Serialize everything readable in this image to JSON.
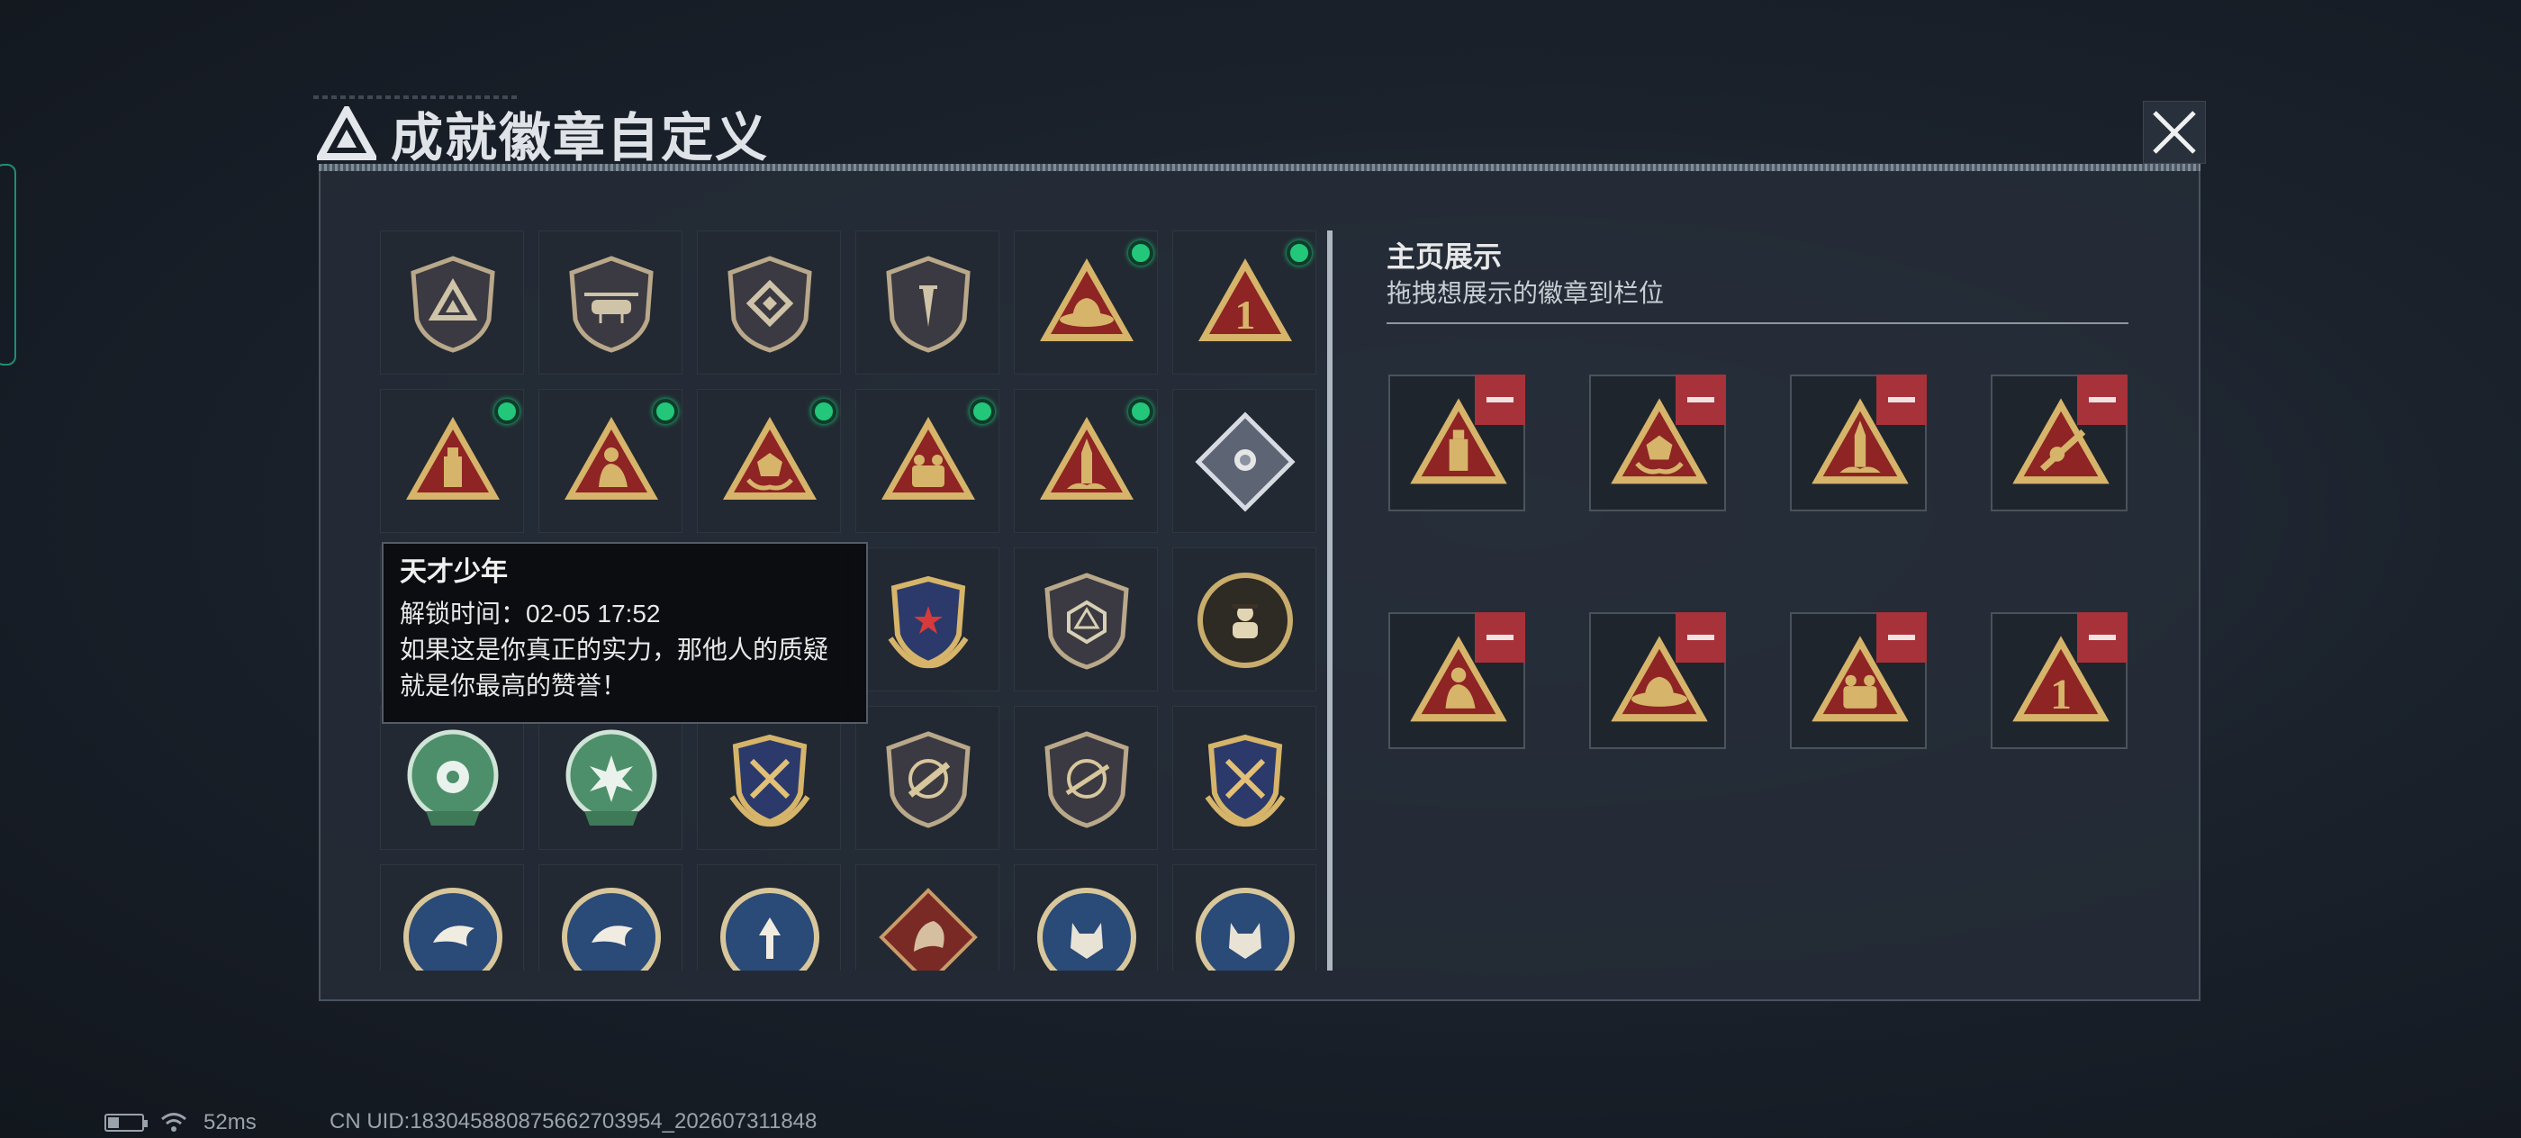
{
  "title": "成就徽章自定义",
  "grid": {
    "cells": [
      {
        "icon": "shield-triangle-badge-icon",
        "kind": "shield",
        "glyph": "triangle",
        "unlocked": false
      },
      {
        "icon": "helicopter-badge-icon",
        "kind": "shield",
        "glyph": "heli",
        "unlocked": false
      },
      {
        "icon": "diamond-emblem-badge-icon",
        "kind": "shield",
        "glyph": "diamond",
        "unlocked": false
      },
      {
        "icon": "dagger-badge-icon",
        "kind": "shield",
        "glyph": "dagger",
        "unlocked": false
      },
      {
        "icon": "hat-triangle-badge-icon",
        "kind": "triangle",
        "glyph": "hat",
        "unlocked": true
      },
      {
        "icon": "number-one-triangle-badge-icon",
        "kind": "triangle",
        "glyph": "one",
        "unlocked": true
      },
      {
        "icon": "usb-drive-triangle-badge-icon",
        "kind": "triangle",
        "glyph": "usb",
        "unlocked": true
      },
      {
        "icon": "kneeling-figure-triangle-badge-icon",
        "kind": "triangle",
        "glyph": "figure",
        "unlocked": true
      },
      {
        "icon": "dice-hands-triangle-badge-icon",
        "kind": "triangle",
        "glyph": "dice",
        "unlocked": true
      },
      {
        "icon": "soldiers-triangle-badge-icon",
        "kind": "triangle",
        "glyph": "soldiers",
        "unlocked": true
      },
      {
        "icon": "rocket-triangle-badge-icon",
        "kind": "triangle",
        "glyph": "rocket",
        "unlocked": true
      },
      {
        "icon": "rose-diamond-badge-icon",
        "kind": "diamond",
        "glyph": "rose",
        "unlocked": false
      },
      {
        "icon": "hidden-badge-icon",
        "kind": "hidden",
        "glyph": "none",
        "unlocked": false
      },
      {
        "icon": "hidden-badge-icon",
        "kind": "hidden",
        "glyph": "none",
        "unlocked": false
      },
      {
        "icon": "hidden-badge-icon",
        "kind": "hidden",
        "glyph": "none",
        "unlocked": false
      },
      {
        "icon": "star-crest-badge-icon",
        "kind": "crest",
        "glyph": "star",
        "unlocked": false
      },
      {
        "icon": "d20-shield-badge-icon",
        "kind": "shield",
        "glyph": "d20",
        "unlocked": false
      },
      {
        "icon": "spy-circle-badge-icon",
        "kind": "circle",
        "glyph": "spy",
        "unlocked": false
      },
      {
        "icon": "green-mech-badge-icon",
        "kind": "green",
        "glyph": "mech",
        "unlocked": false
      },
      {
        "icon": "green-burst-badge-icon",
        "kind": "green",
        "glyph": "burst",
        "unlocked": false
      },
      {
        "icon": "crossed-rifles-crest-badge-icon",
        "kind": "crest",
        "glyph": "rifles",
        "unlocked": false
      },
      {
        "icon": "rifle-shield-badge-icon",
        "kind": "shield",
        "glyph": "rifle",
        "unlocked": false
      },
      {
        "icon": "sniper-shield-badge-icon",
        "kind": "shield",
        "glyph": "sniper",
        "unlocked": false
      },
      {
        "icon": "crossed-rifles-crest-badge-icon",
        "kind": "crest",
        "glyph": "rifles",
        "unlocked": false
      },
      {
        "icon": "eagle-medal-badge-icon",
        "kind": "round",
        "glyph": "eagle",
        "unlocked": false
      },
      {
        "icon": "eagle-medal-badge-icon",
        "kind": "round",
        "glyph": "eagle",
        "unlocked": false
      },
      {
        "icon": "arrow-medal-badge-icon",
        "kind": "round",
        "glyph": "arrow",
        "unlocked": false
      },
      {
        "icon": "dragon-diamond-badge-icon",
        "kind": "dragon",
        "glyph": "dragon",
        "unlocked": false
      },
      {
        "icon": "wolf-medal-badge-icon",
        "kind": "round",
        "glyph": "wolf",
        "unlocked": false
      },
      {
        "icon": "wolf-medal-badge-icon",
        "kind": "round",
        "glyph": "wolf",
        "unlocked": false
      }
    ]
  },
  "tooltip": {
    "name": "天才少年",
    "unlock_time": "解锁时间：02-05 17:52",
    "description": "如果这是你真正的实力，那他人的质疑就是你最高的赞誉！"
  },
  "showcase": {
    "title": "主页展示",
    "subtitle": "拖拽想展示的徽章到栏位",
    "slots": [
      {
        "icon": "usb-drive-triangle-badge-icon",
        "glyph": "usb"
      },
      {
        "icon": "dice-hands-triangle-badge-icon",
        "glyph": "dice"
      },
      {
        "icon": "rocket-triangle-badge-icon",
        "glyph": "rocket"
      },
      {
        "icon": "rifle-arm-triangle-badge-icon",
        "glyph": "arm"
      },
      {
        "icon": "kneeling-figure-triangle-badge-icon",
        "glyph": "figure"
      },
      {
        "icon": "hat-triangle-badge-icon",
        "glyph": "hat"
      },
      {
        "icon": "soldiers-triangle-badge-icon",
        "glyph": "soldiers"
      },
      {
        "icon": "number-one-triangle-badge-icon",
        "glyph": "one"
      }
    ]
  },
  "status": {
    "ping": "52ms",
    "uid": "CN UID:18304588087566270395​4_202607311848"
  },
  "colors": {
    "gold": "#d6b46a",
    "red_triangle": "#8e2424",
    "green_dot": "#23c77a",
    "remove_red": "#a8323a",
    "panel": "#262d38"
  }
}
